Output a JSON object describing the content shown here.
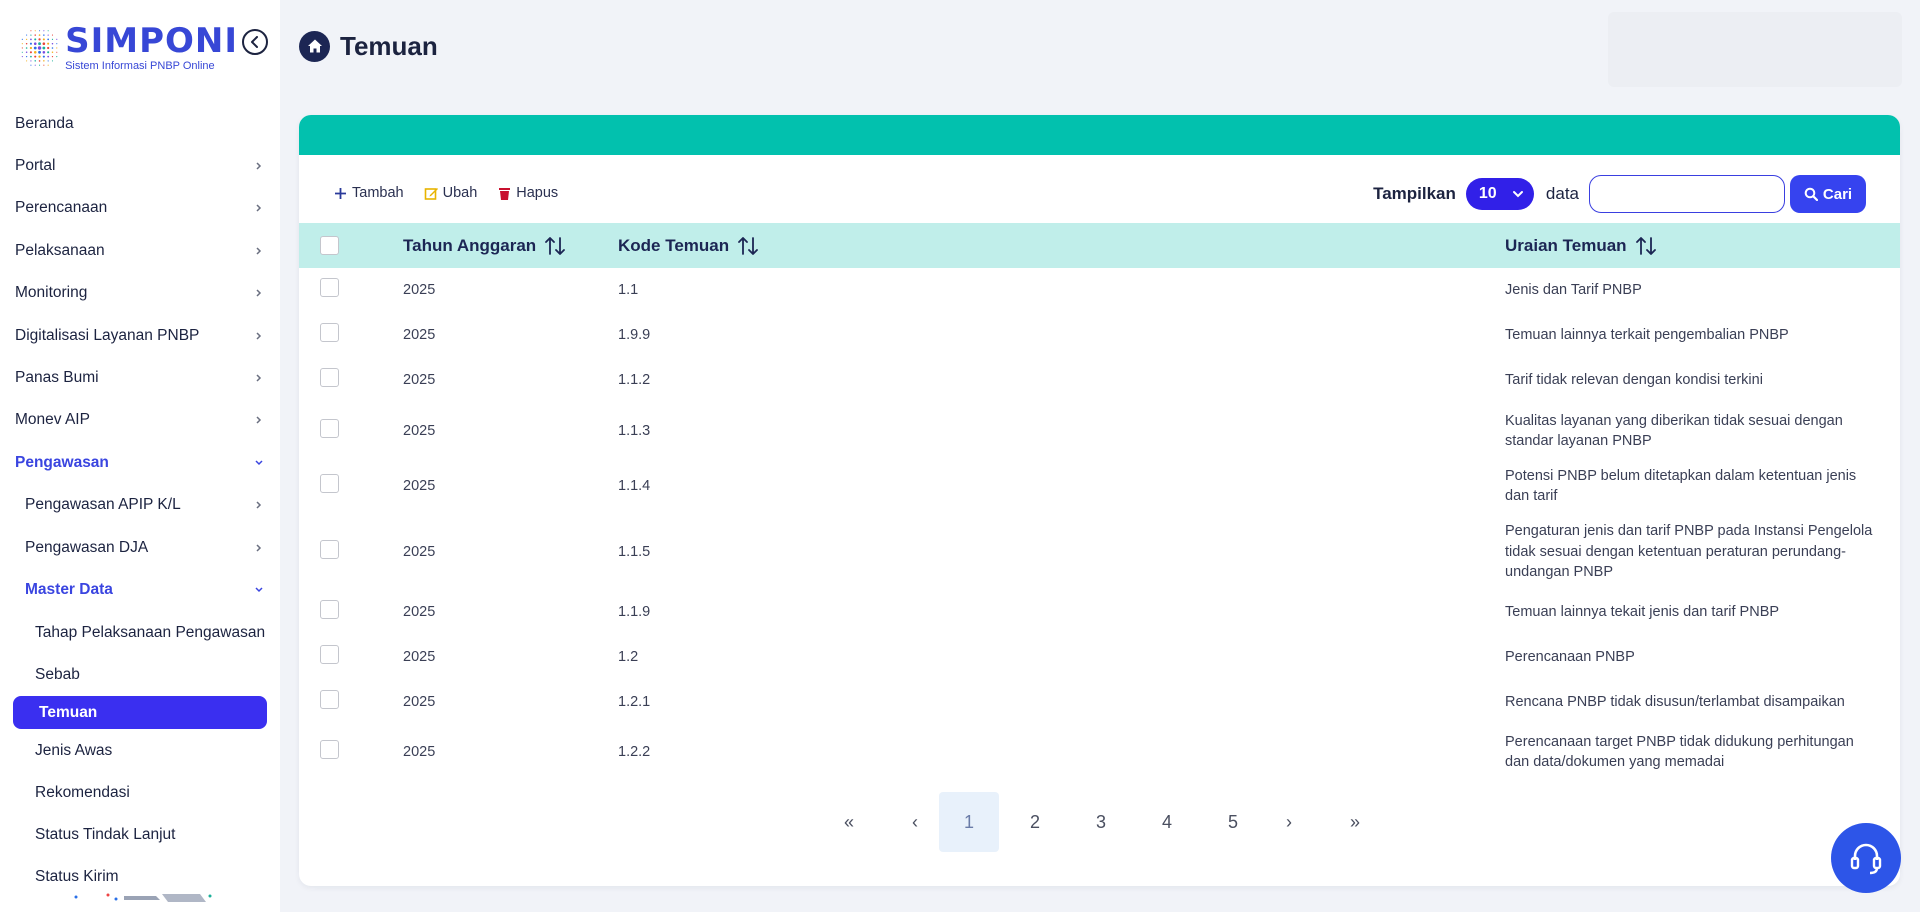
{
  "brand": {
    "name": "SIMPONI",
    "tagline": "Sistem Informasi PNBP Online",
    "color": "#3747d6"
  },
  "sidebar": {
    "items": [
      {
        "label": "Beranda",
        "level": 0,
        "chevron": false,
        "state": ""
      },
      {
        "label": "Portal",
        "level": 0,
        "chevron": "right",
        "state": ""
      },
      {
        "label": "Perencanaan",
        "level": 0,
        "chevron": "right",
        "state": ""
      },
      {
        "label": "Pelaksanaan",
        "level": 0,
        "chevron": "right",
        "state": ""
      },
      {
        "label": "Monitoring",
        "level": 0,
        "chevron": "right",
        "state": ""
      },
      {
        "label": "Digitalisasi Layanan PNBP",
        "level": 0,
        "chevron": "right",
        "state": ""
      },
      {
        "label": "Panas Bumi",
        "level": 0,
        "chevron": "right",
        "state": ""
      },
      {
        "label": "Monev AIP",
        "level": 0,
        "chevron": "right",
        "state": ""
      },
      {
        "label": "Pengawasan",
        "level": 0,
        "chevron": "down",
        "state": "open"
      },
      {
        "label": "Pengawasan APIP K/L",
        "level": 1,
        "chevron": "right",
        "state": ""
      },
      {
        "label": "Pengawasan DJA",
        "level": 1,
        "chevron": "right",
        "state": ""
      },
      {
        "label": "Master Data",
        "level": 1,
        "chevron": "down",
        "state": "open"
      },
      {
        "label": "Tahap Pelaksanaan Pengawasan",
        "level": 2,
        "chevron": false,
        "state": ""
      },
      {
        "label": "Sebab",
        "level": 2,
        "chevron": false,
        "state": ""
      },
      {
        "label": "Temuan",
        "level": 2,
        "chevron": false,
        "state": "active"
      },
      {
        "label": "Jenis Awas",
        "level": 2,
        "chevron": false,
        "state": ""
      },
      {
        "label": "Rekomendasi",
        "level": 2,
        "chevron": false,
        "state": ""
      },
      {
        "label": "Status Tindak Lanjut",
        "level": 2,
        "chevron": false,
        "state": ""
      },
      {
        "label": "Status Kirim",
        "level": 2,
        "chevron": false,
        "state": ""
      }
    ]
  },
  "header": {
    "title": "Temuan"
  },
  "toolbar": {
    "add_label": "Tambah",
    "edit_label": "Ubah",
    "delete_label": "Hapus",
    "show_label": "Tampilkan",
    "page_size": "10",
    "data_label": "data",
    "search_placeholder": "",
    "search_label": "Cari"
  },
  "table": {
    "columns": [
      "Tahun Anggaran",
      "Kode Temuan",
      "Uraian Temuan"
    ],
    "rows": [
      {
        "tahun": "2025",
        "kode": "1.1",
        "uraian": "Jenis dan Tarif PNBP"
      },
      {
        "tahun": "2025",
        "kode": "1.9.9",
        "uraian": "Temuan lainnya terkait pengembalian PNBP"
      },
      {
        "tahun": "2025",
        "kode": "1.1.2",
        "uraian": "Tarif tidak relevan dengan kondisi terkini"
      },
      {
        "tahun": "2025",
        "kode": "1.1.3",
        "uraian": "Kualitas layanan yang diberikan tidak sesuai dengan standar layanan PNBP"
      },
      {
        "tahun": "2025",
        "kode": "1.1.4",
        "uraian": "Potensi PNBP belum ditetapkan dalam ketentuan jenis dan tarif"
      },
      {
        "tahun": "2025",
        "kode": "1.1.5",
        "uraian": "Pengaturan jenis dan tarif PNBP pada Instansi Pengelola tidak sesuai dengan ketentuan peraturan perundang-undangan PNBP"
      },
      {
        "tahun": "2025",
        "kode": "1.1.9",
        "uraian": "Temuan lainnya tekait jenis dan tarif PNBP"
      },
      {
        "tahun": "2025",
        "kode": "1.2",
        "uraian": "Perencanaan PNBP"
      },
      {
        "tahun": "2025",
        "kode": "1.2.1",
        "uraian": "Rencana PNBP tidak disusun/terlambat disampaikan"
      },
      {
        "tahun": "2025",
        "kode": "1.2.2",
        "uraian": "Perencanaan target PNBP tidak didukung perhitungan dan data/dokumen yang memadai"
      }
    ]
  },
  "pagination": {
    "first": "«",
    "prev": "‹",
    "pages": [
      "1",
      "2",
      "3",
      "4",
      "5"
    ],
    "current": "1",
    "next": "›",
    "last": "»"
  },
  "colors": {
    "accent": "#3a2ff0",
    "band": "#02c1ae",
    "table_header": "#c0eeea",
    "help": "#2d55e8"
  }
}
